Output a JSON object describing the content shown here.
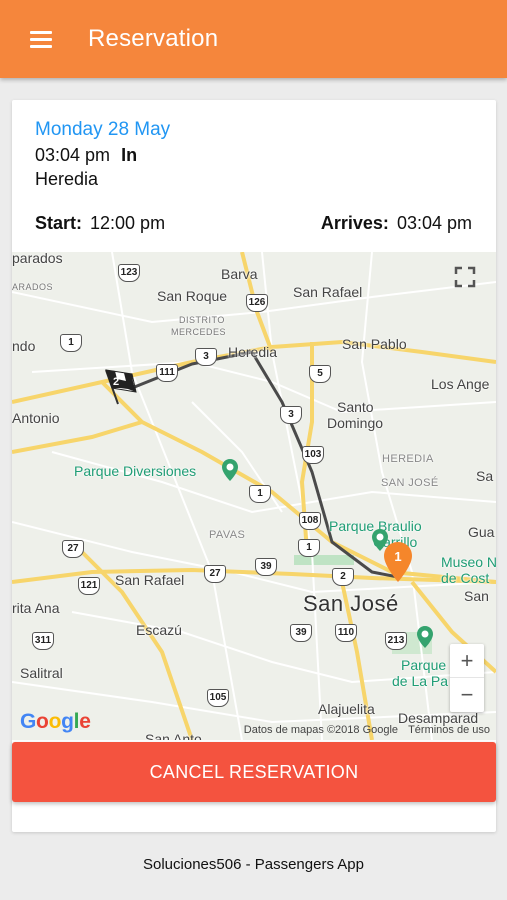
{
  "appbar": {
    "title": "Reservation"
  },
  "reservation": {
    "date": "Monday 28 May",
    "time": "03:04 pm",
    "direction": "In",
    "place": "Heredia",
    "start_label": "Start:",
    "start_time": "12:00 pm",
    "arrives_label": "Arrives:",
    "arrives_time": "03:04 pm"
  },
  "map": {
    "labels": {
      "parados": "parados",
      "arados": "ARADOS",
      "barva": "Barva",
      "san_roque": "San Roque",
      "san_rafael_n": "San Rafael",
      "distrito": "DISTRITO",
      "mercedes": "MERCEDES",
      "ndo": "ndo",
      "heredia": "Heredia",
      "san_pablo": "San Pablo",
      "los_ange": "Los Ange",
      "antonio": "Antonio",
      "santo": "Santo",
      "domingo": "Domingo",
      "parque_diversiones": "Parque Diversiones",
      "heredia_caps": "HEREDIA",
      "san_jose_caps": "SAN JOSÉ",
      "sa": "Sa",
      "parque_braulio": "Parque Braulio",
      "carrillo": "Carrillo",
      "gua": "Gua",
      "pavas": "PAVAS",
      "museo": "Museo N",
      "de_cost": "de Cost",
      "san_rafael_w": "San Rafael",
      "san": "San",
      "san_jose": "San José",
      "rita_ana": "rita Ana",
      "escazu": "Escazú",
      "salitral": "Salitral",
      "parque_la_paz": "Parque",
      "de_la_pa": "de La Pa",
      "alajuelita": "Alajuelita",
      "desamparad": "Desamparad",
      "san_anto": "San Anto"
    },
    "shields": [
      "123",
      "126",
      "1",
      "3",
      "111",
      "5",
      "3",
      "103",
      "1",
      "108",
      "27",
      "1",
      "121",
      "27",
      "39",
      "2",
      "311",
      "39",
      "110",
      "213",
      "105"
    ],
    "marker_number": "1",
    "flag_number": "2",
    "zoom_in": "+",
    "zoom_out": "−",
    "google": "Google",
    "credits": "Datos de mapas ©2018 Google",
    "terms": "Términos de uso"
  },
  "actions": {
    "cancel_label": "CANCEL RESERVATION"
  },
  "footer": {
    "text": "Soluciones506 - Passengers App"
  },
  "colors": {
    "appbar": "#f5863c",
    "cancel": "#f4533f",
    "date": "#2196f3"
  }
}
